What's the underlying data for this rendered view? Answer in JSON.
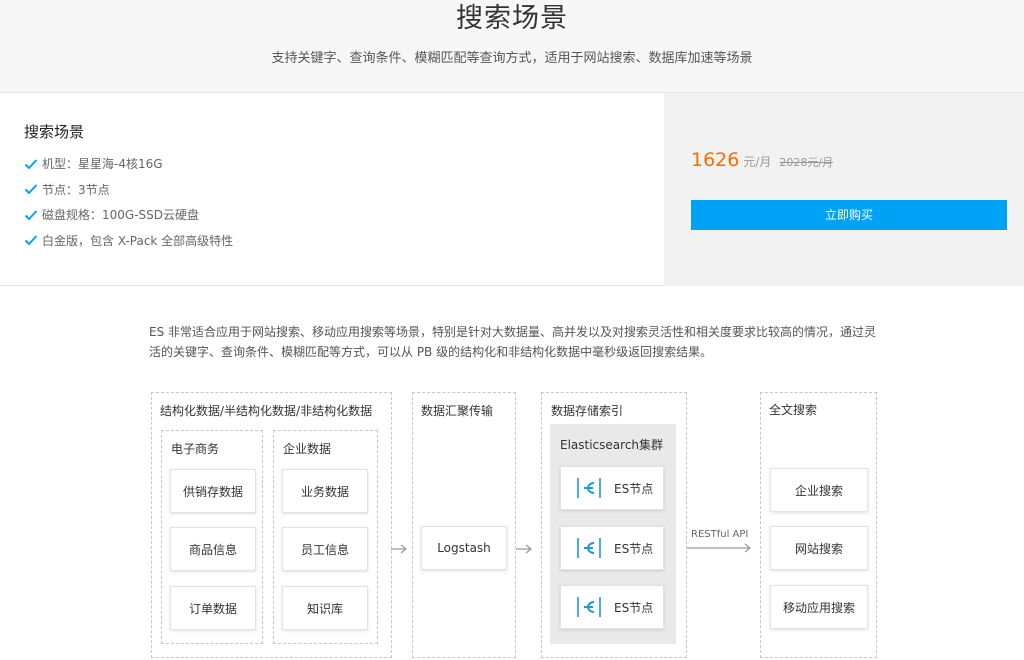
{
  "hero": {
    "title": "搜索场景",
    "subtitle": "支持关键字、查询条件、模糊匹配等查询方式，适用于网站搜索、数据库加速等场景"
  },
  "plan": {
    "name": "搜索场景",
    "features": [
      "机型：星星海-4核16G",
      "节点：3节点",
      "磁盘规格：100G-SSD云硬盘",
      "白金版，包含 X-Pack 全部高级特性"
    ],
    "price": "1626",
    "price_unit": "元/月",
    "original_price": "2028元/月",
    "buy_label": "立即购买"
  },
  "description": "ES 非常适合应用于网站搜索、移动应用搜索等场景，特别是针对大数据量、高并发以及对搜索灵活性和相关度要求比较高的情况，通过灵活的关键字、查询条件、模糊匹配等方式，可以从 PB 级的结构化和非结构化数据中毫秒级返回搜索结果。",
  "diagram": {
    "source": {
      "title": "结构化数据/半结构化数据/非结构化数据",
      "ecommerce": {
        "title": "电子商务",
        "items": [
          "供销存数据",
          "商品信息",
          "订单数据"
        ]
      },
      "enterprise": {
        "title": "企业数据",
        "items": [
          "业务数据",
          "员工信息",
          "知识库"
        ]
      }
    },
    "transport": {
      "title": "数据汇聚传输",
      "node": "Logstash"
    },
    "storage": {
      "title": "数据存储索引",
      "cluster_title": "Elasticsearch集群",
      "nodes": [
        "ES节点",
        "ES节点",
        "ES节点"
      ]
    },
    "api_label": "RESTful API",
    "search": {
      "title": "全文搜索",
      "items": [
        "企业搜索",
        "网站搜索",
        "移动应用搜索"
      ]
    }
  },
  "colors": {
    "accent": "#00a2f5",
    "price": "#ff6a00",
    "check": "#00a2f5"
  },
  "icons": {
    "check": "check-icon",
    "es": "elasticsearch-icon",
    "arrow": "arrow-right-icon"
  }
}
